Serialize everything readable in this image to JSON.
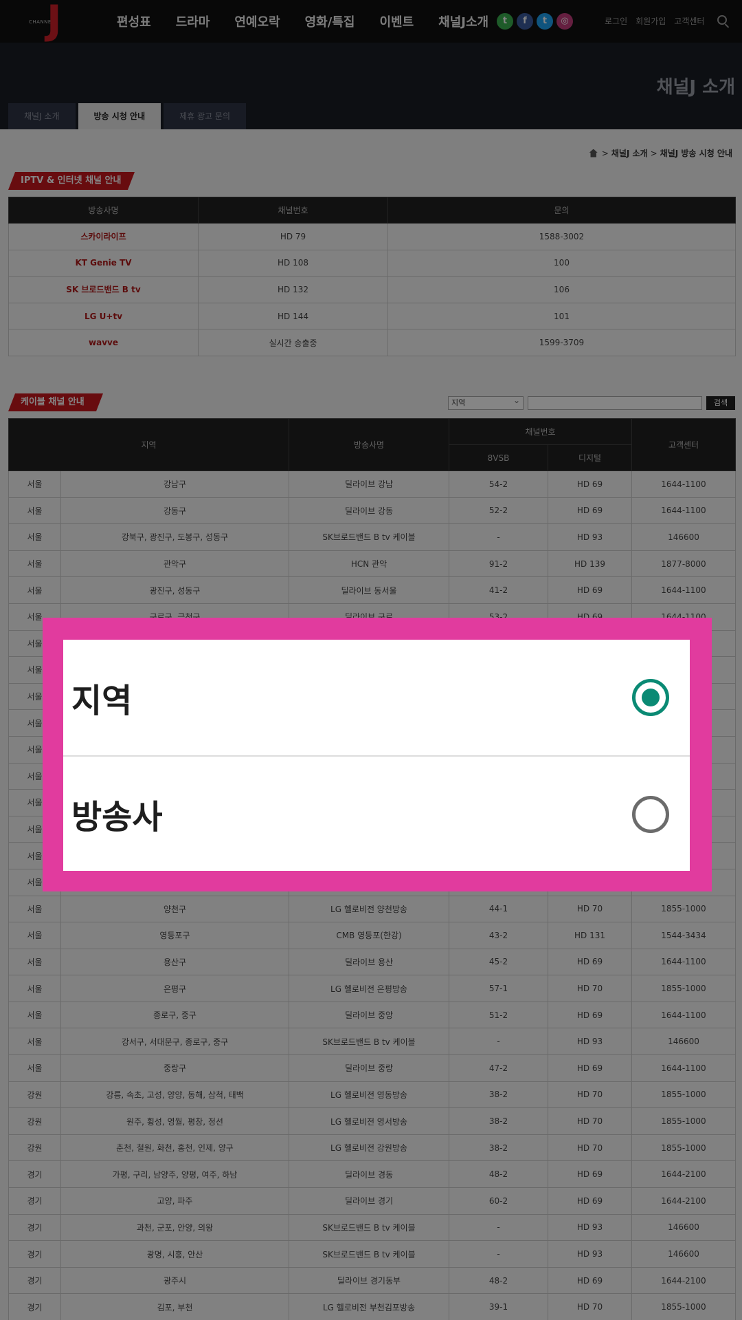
{
  "header": {
    "logo_small": "CHANNEL",
    "logo_letter": "J",
    "nav": [
      "편성표",
      "드라마",
      "연예오락",
      "영화/특집",
      "이벤트",
      "채널J소개"
    ],
    "social": [
      {
        "name": "talk-icon",
        "color": "#3aaf50",
        "glyph": "t"
      },
      {
        "name": "facebook-icon",
        "color": "#3b5a9d",
        "glyph": "f"
      },
      {
        "name": "twitter-icon",
        "color": "#1da1f2",
        "glyph": "t"
      },
      {
        "name": "instagram-icon",
        "color": "#c23d7c",
        "glyph": "◎"
      }
    ],
    "util": [
      "로그인",
      "회원가입",
      "고객센터"
    ]
  },
  "subheader": {
    "title": "채널J 소개",
    "tabs": [
      "채널J 소개",
      "방송 시청 안내",
      "제휴 광고 문의"
    ],
    "active_tab": 1
  },
  "breadcrumb": {
    "sep": ">",
    "items": [
      "채널J 소개",
      "채널J 방송 시청 안내"
    ]
  },
  "iptv": {
    "tag": "IPTV & 인터넷 채널 안내",
    "headers": [
      "방송사명",
      "채널번호",
      "문의"
    ],
    "rows": [
      [
        "스카이라이프",
        "HD 79",
        "1588-3002"
      ],
      [
        "KT Genie TV",
        "HD 108",
        "100"
      ],
      [
        "SK 브로드밴드 B tv",
        "HD 132",
        "106"
      ],
      [
        "LG U+tv",
        "HD 144",
        "101"
      ],
      [
        "wavve",
        "실시간 송출중",
        "1599-3709"
      ]
    ]
  },
  "cable": {
    "tag": "케이블 채널 안내",
    "select_value": "지역",
    "search_button": "검색",
    "headers": {
      "region": "지역",
      "provider": "방송사명",
      "channel": "채널번호",
      "vsb": "8VSB",
      "digital": "디지털",
      "center": "고객센터"
    },
    "rows": [
      [
        "서울",
        "강남구",
        "딜라이브 강남",
        "54-2",
        "HD 69",
        "1644-1100"
      ],
      [
        "서울",
        "강동구",
        "딜라이브 강동",
        "52-2",
        "HD 69",
        "1644-1100"
      ],
      [
        "서울",
        "강북구, 광진구, 도봉구, 성동구",
        "SK브로드밴드 B tv 케이블",
        "-",
        "HD 93",
        "146600"
      ],
      [
        "서울",
        "관악구",
        "HCN 관악",
        "91-2",
        "HD 139",
        "1877-8000"
      ],
      [
        "서울",
        "광진구, 성동구",
        "딜라이브 동서울",
        "41-2",
        "HD 69",
        "1644-1100"
      ],
      [
        "서울",
        "구로구, 금천구",
        "딜라이브 구로",
        "53-2",
        "HD 69",
        "1644-1100"
      ],
      [
        "서울",
        "",
        "",
        "",
        "",
        ""
      ],
      [
        "서울",
        "",
        "",
        "",
        "",
        ""
      ],
      [
        "서울",
        "",
        "",
        "",
        "",
        ""
      ],
      [
        "서울",
        "",
        "",
        "",
        "",
        ""
      ],
      [
        "서울",
        "",
        "",
        "",
        "",
        ""
      ],
      [
        "서울",
        "",
        "",
        "",
        "",
        ""
      ],
      [
        "서울",
        "",
        "",
        "",
        "",
        ""
      ],
      [
        "서울",
        "",
        "",
        "",
        "",
        ""
      ],
      [
        "서울",
        "",
        "",
        "",
        "",
        ""
      ],
      [
        "서울",
        "",
        "",
        "",
        "",
        ""
      ],
      [
        "서울",
        "양천구",
        "LG 헬로비전 양천방송",
        "44-1",
        "HD 70",
        "1855-1000"
      ],
      [
        "서울",
        "영등포구",
        "CMB 영등포(한강)",
        "43-2",
        "HD 131",
        "1544-3434"
      ],
      [
        "서울",
        "용산구",
        "딜라이브 용산",
        "45-2",
        "HD 69",
        "1644-1100"
      ],
      [
        "서울",
        "은평구",
        "LG 헬로비전 은평방송",
        "57-1",
        "HD 70",
        "1855-1000"
      ],
      [
        "서울",
        "종로구, 중구",
        "딜라이브 중앙",
        "51-2",
        "HD 69",
        "1644-1100"
      ],
      [
        "서울",
        "강서구, 서대문구, 종로구, 중구",
        "SK브로드밴드 B tv 케이블",
        "-",
        "HD 93",
        "146600"
      ],
      [
        "서울",
        "중랑구",
        "딜라이브 중랑",
        "47-2",
        "HD 69",
        "1644-1100"
      ],
      [
        "강원",
        "강릉, 속초, 고성, 양양, 동해, 삼척, 태백",
        "LG 헬로비전 영동방송",
        "38-2",
        "HD 70",
        "1855-1000"
      ],
      [
        "강원",
        "원주, 횡성, 영월, 평창, 정선",
        "LG 헬로비전 영서방송",
        "38-2",
        "HD 70",
        "1855-1000"
      ],
      [
        "강원",
        "춘천, 철원, 화천, 홍천, 인제, 양구",
        "LG 헬로비전 강원방송",
        "38-2",
        "HD 70",
        "1855-1000"
      ],
      [
        "경기",
        "가평, 구리, 남양주, 양평, 여주, 하남",
        "딜라이브 경동",
        "48-2",
        "HD 69",
        "1644-2100"
      ],
      [
        "경기",
        "고양, 파주",
        "딜라이브 경기",
        "60-2",
        "HD 69",
        "1644-2100"
      ],
      [
        "경기",
        "과천, 군포, 안양, 의왕",
        "SK브로드밴드 B tv 케이블",
        "-",
        "HD 93",
        "146600"
      ],
      [
        "경기",
        "광명, 시흥, 안산",
        "SK브로드밴드 B tv 케이블",
        "-",
        "HD 93",
        "146600"
      ],
      [
        "경기",
        "광주시",
        "딜라이브 경기동부",
        "48-2",
        "HD 69",
        "1644-2100"
      ],
      [
        "경기",
        "김포, 부천",
        "LG 헬로비전 부천김포방송",
        "39-1",
        "HD 70",
        "1855-1000"
      ]
    ]
  },
  "dialog": {
    "options": [
      {
        "label": "지역",
        "selected": true
      },
      {
        "label": "방송사",
        "selected": false
      }
    ],
    "accent": "#0a8a74",
    "frame_color": "#e13b9e"
  }
}
